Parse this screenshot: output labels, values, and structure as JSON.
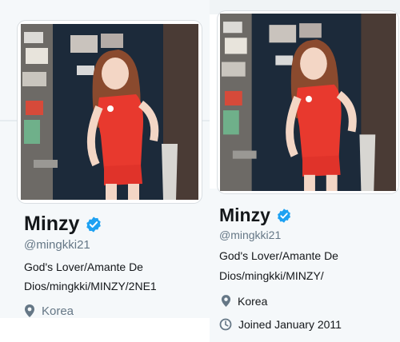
{
  "left_profile": {
    "name": "Minzy",
    "handle": "@mingkki21",
    "bio_line1": "God's Lover/Amante De",
    "bio_line2": "Dios/mingkki/MINZY/2NE1",
    "location": "Korea"
  },
  "right_profile": {
    "name": "Minzy",
    "handle": "@mingkki21",
    "bio_line1": "God's Lover/Amante De",
    "bio_line2": "Dios/mingkki/MINZY/",
    "location": "Korea",
    "joined": "Joined January 2011"
  },
  "colors": {
    "verified_badge": "#1da1f2",
    "shirt": "#e8392e",
    "door": "#1c2a3a"
  },
  "icons": {
    "verified": "verified-badge-icon",
    "location": "location-pin-icon",
    "calendar": "calendar-clock-icon"
  }
}
